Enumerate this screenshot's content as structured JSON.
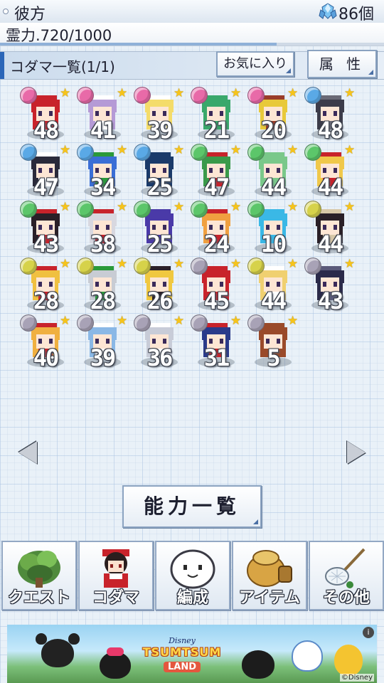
{
  "header": {
    "location": "彼方",
    "gem_icon": "crystal-gem-icon",
    "gem_count": "86個"
  },
  "spirit": {
    "label": "霊力.720/1000",
    "fraction": 0.72
  },
  "list": {
    "title": "コダマ一覧(1/1)",
    "favorites_button": "お気に入り",
    "attribute_button": "属 性"
  },
  "colors": {
    "accent": "#2b66b8",
    "orb_pink": "#e86aa8",
    "orb_blue": "#5aa9e6",
    "orb_green": "#5cc66a",
    "orb_yellow": "#d6d24a",
    "orb_gray": "#a8a2b6",
    "star": "#f6c41a"
  },
  "kodama": [
    {
      "level": "48",
      "orb": "pink",
      "hair": "#c8232b",
      "hat": "#c8232b"
    },
    {
      "level": "41",
      "orb": "pink",
      "hair": "#b59ad6",
      "hat": "#ffffff"
    },
    {
      "level": "39",
      "orb": "pink",
      "hair": "#f4dc6a",
      "hat": "#ffffff"
    },
    {
      "level": "21",
      "orb": "pink",
      "hair": "#39a86b",
      "hat": "#39a86b"
    },
    {
      "level": "20",
      "orb": "pink",
      "hair": "#e8c93a",
      "hat": "#9a3d2a"
    },
    {
      "level": "48",
      "orb": "blue",
      "hair": "#3c3c4a",
      "hat": "#6a6a76"
    },
    {
      "level": "47",
      "orb": "blue",
      "hair": "#2a2a3a",
      "hat": "#ffffff"
    },
    {
      "level": "34",
      "orb": "blue",
      "hair": "#3a6ed6",
      "hat": "#2a9a3a"
    },
    {
      "level": "25",
      "orb": "blue",
      "hair": "#1a3a6a",
      "hat": "#1a3a6a"
    },
    {
      "level": "47",
      "orb": "green",
      "hair": "#3a9a4a",
      "hat": "#c8232b"
    },
    {
      "level": "44",
      "orb": "green",
      "hair": "#7ac88a",
      "hat": "#7ac88a"
    },
    {
      "level": "44",
      "orb": "green",
      "hair": "#f0c84a",
      "hat": "#c8232b"
    },
    {
      "level": "43",
      "orb": "green",
      "hair": "#2a2028",
      "hat": "#c8232b"
    },
    {
      "level": "38",
      "orb": "green",
      "hair": "#d8d8e0",
      "hat": "#c8232b"
    },
    {
      "level": "25",
      "orb": "green",
      "hair": "#4a3aa8",
      "hat": "#4a3aa8"
    },
    {
      "level": "24",
      "orb": "green",
      "hair": "#f0a040",
      "hat": "#c8232b"
    },
    {
      "level": "10",
      "orb": "green",
      "hair": "#3ab8e6",
      "hat": "#3ab8e6"
    },
    {
      "level": "44",
      "orb": "yellow",
      "hair": "#2a2028",
      "hat": "#d8c8a8"
    },
    {
      "level": "28",
      "orb": "yellow",
      "hair": "#f0c040",
      "hat": "#c8232b"
    },
    {
      "level": "28",
      "orb": "yellow",
      "hair": "#c8ccd4",
      "hat": "#2a9a3a"
    },
    {
      "level": "26",
      "orb": "yellow",
      "hair": "#f0c840",
      "hat": "#2a2028"
    },
    {
      "level": "45",
      "orb": "gray",
      "hair": "#c8232b",
      "hat": "#c8232b"
    },
    {
      "level": "44",
      "orb": "yellow",
      "hair": "#f0d070",
      "hat": "#ffffff"
    },
    {
      "level": "43",
      "orb": "gray",
      "hair": "#2a2a4a",
      "hat": "#5a5a7a"
    },
    {
      "level": "40",
      "orb": "gray",
      "hair": "#f0b040",
      "hat": "#c8232b"
    },
    {
      "level": "39",
      "orb": "gray",
      "hair": "#8ab8e6",
      "hat": "#ffffff"
    },
    {
      "level": "36",
      "orb": "gray",
      "hair": "#c8ccd8",
      "hat": "#ffffff"
    },
    {
      "level": "31",
      "orb": "gray",
      "hair": "#2a3a8a",
      "hat": "#c8232b"
    },
    {
      "level": "5",
      "orb": "gray",
      "hair": "#9a4a2a",
      "hat": "#9a4a2a"
    }
  ],
  "ability_button": "能力一覧",
  "nav": [
    {
      "label": "クエスト",
      "icon": "forest-quest-icon"
    },
    {
      "label": "コダマ",
      "icon": "shrine-maiden-icon"
    },
    {
      "label": "編成",
      "icon": "white-blob-icon"
    },
    {
      "label": "アイテム",
      "icon": "item-bag-icon"
    },
    {
      "label": "その他",
      "icon": "bug-net-icon"
    }
  ],
  "ad": {
    "brand": "Disney",
    "title": "TSUMTSUM",
    "subtitle": "LAND",
    "copyright": "©Disney",
    "info": "i"
  }
}
